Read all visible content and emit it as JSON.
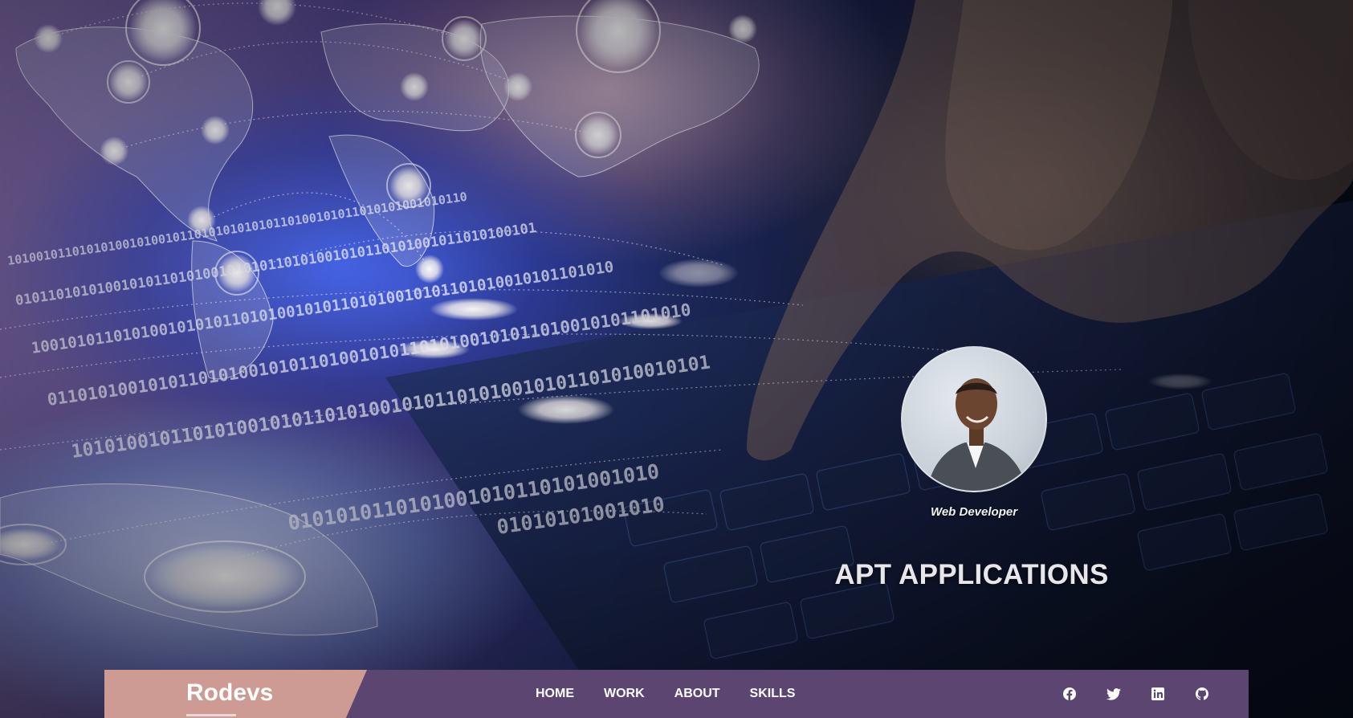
{
  "hero": {
    "role": "Web Developer",
    "headline": "APT APPLICATIONS"
  },
  "navbar": {
    "brand": "Rodevs",
    "menu": [
      {
        "label": "HOME"
      },
      {
        "label": "WORK"
      },
      {
        "label": "ABOUT"
      },
      {
        "label": "SKILLS"
      }
    ],
    "social": [
      {
        "icon": "facebook-icon"
      },
      {
        "icon": "twitter-icon"
      },
      {
        "icon": "linkedin-icon"
      },
      {
        "icon": "github-icon"
      }
    ]
  },
  "colors": {
    "navbar": "#5c4570",
    "brand_block": "#cd9b94",
    "text": "#ffffff"
  }
}
